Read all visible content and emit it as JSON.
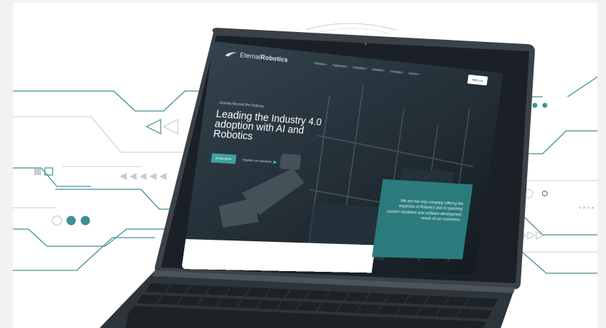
{
  "image": {
    "description_alt": "Laptop showing Eternal Robotics website over a circuit-line graphic"
  },
  "website": {
    "logo_prefix": "Eternal",
    "logo_bold": "Robotics",
    "nav": [
      "Robotics ›",
      "Hyperview ›",
      "Industries ›",
      "Solutions ›",
      "Company ›",
      "Careers ›"
    ],
    "talk_button": "Talk to us",
    "eyebrow": "Journey Beyond the Ordinary",
    "headline": "Leading the Industry 4.0 adoption with AI and Robotics",
    "cta_primary": "Know More",
    "cta_secondary": "Explore our solutions",
    "card_text": "We are the only company offering the expertise of Robotics and AI spanning custom hardware and software development needs of our customers."
  },
  "colors": {
    "teal": "#3f9fa0",
    "teal_dark": "#2c7b7c",
    "line": "#3f8f93",
    "line_light": "#c7cccf"
  }
}
